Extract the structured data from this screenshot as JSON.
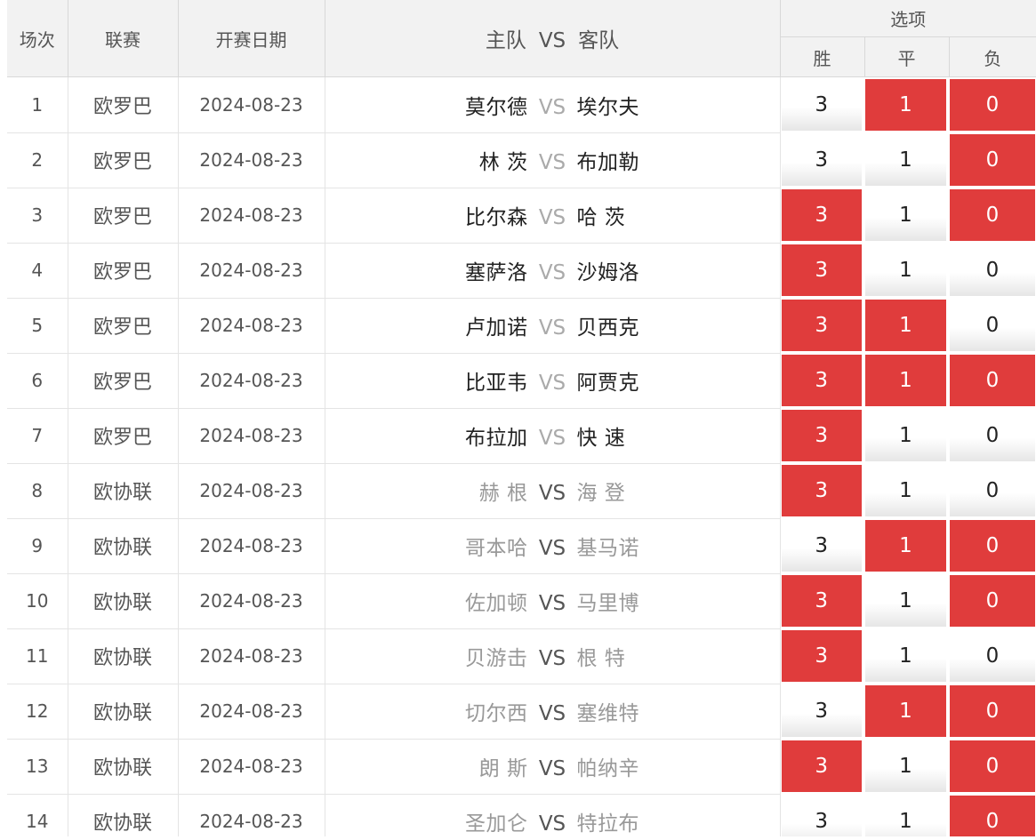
{
  "header": {
    "index": "场次",
    "league": "联赛",
    "date": "开赛日期",
    "home": "主队",
    "vs": "VS",
    "away": "客队",
    "options": "选项",
    "win": "胜",
    "draw": "平",
    "lose": "负"
  },
  "accent_color": "#e03c3c",
  "rows": [
    {
      "index": "1",
      "league": "欧罗巴",
      "date": "2024-08-23",
      "home": "莫尔德",
      "vs": "VS",
      "away": "埃尔夫",
      "style": "dark",
      "win": "3",
      "draw": "1",
      "lose": "0",
      "sel": [
        false,
        true,
        true
      ]
    },
    {
      "index": "2",
      "league": "欧罗巴",
      "date": "2024-08-23",
      "home": "林 茨",
      "vs": "VS",
      "away": "布加勒",
      "style": "dark",
      "win": "3",
      "draw": "1",
      "lose": "0",
      "sel": [
        false,
        false,
        true
      ]
    },
    {
      "index": "3",
      "league": "欧罗巴",
      "date": "2024-08-23",
      "home": "比尔森",
      "vs": "VS",
      "away": "哈 茨",
      "style": "dark",
      "win": "3",
      "draw": "1",
      "lose": "0",
      "sel": [
        true,
        false,
        true
      ]
    },
    {
      "index": "4",
      "league": "欧罗巴",
      "date": "2024-08-23",
      "home": "塞萨洛",
      "vs": "VS",
      "away": "沙姆洛",
      "style": "dark",
      "win": "3",
      "draw": "1",
      "lose": "0",
      "sel": [
        true,
        false,
        false
      ]
    },
    {
      "index": "5",
      "league": "欧罗巴",
      "date": "2024-08-23",
      "home": "卢加诺",
      "vs": "VS",
      "away": "贝西克",
      "style": "dark",
      "win": "3",
      "draw": "1",
      "lose": "0",
      "sel": [
        true,
        true,
        false
      ]
    },
    {
      "index": "6",
      "league": "欧罗巴",
      "date": "2024-08-23",
      "home": "比亚韦",
      "vs": "VS",
      "away": "阿贾克",
      "style": "dark",
      "win": "3",
      "draw": "1",
      "lose": "0",
      "sel": [
        true,
        true,
        true
      ]
    },
    {
      "index": "7",
      "league": "欧罗巴",
      "date": "2024-08-23",
      "home": "布拉加",
      "vs": "VS",
      "away": "快 速",
      "style": "dark",
      "win": "3",
      "draw": "1",
      "lose": "0",
      "sel": [
        true,
        false,
        false
      ]
    },
    {
      "index": "8",
      "league": "欧协联",
      "date": "2024-08-23",
      "home": "赫 根",
      "vs": "VS",
      "away": "海 登",
      "style": "light",
      "win": "3",
      "draw": "1",
      "lose": "0",
      "sel": [
        true,
        false,
        false
      ]
    },
    {
      "index": "9",
      "league": "欧协联",
      "date": "2024-08-23",
      "home": "哥本哈",
      "vs": "VS",
      "away": "基马诺",
      "style": "light",
      "win": "3",
      "draw": "1",
      "lose": "0",
      "sel": [
        false,
        true,
        true
      ]
    },
    {
      "index": "10",
      "league": "欧协联",
      "date": "2024-08-23",
      "home": "佐加顿",
      "vs": "VS",
      "away": "马里博",
      "style": "light",
      "win": "3",
      "draw": "1",
      "lose": "0",
      "sel": [
        true,
        false,
        true
      ]
    },
    {
      "index": "11",
      "league": "欧协联",
      "date": "2024-08-23",
      "home": "贝游击",
      "vs": "VS",
      "away": "根 特",
      "style": "light",
      "win": "3",
      "draw": "1",
      "lose": "0",
      "sel": [
        true,
        false,
        false
      ]
    },
    {
      "index": "12",
      "league": "欧协联",
      "date": "2024-08-23",
      "home": "切尔西",
      "vs": "VS",
      "away": "塞维特",
      "style": "light",
      "win": "3",
      "draw": "1",
      "lose": "0",
      "sel": [
        false,
        true,
        true
      ]
    },
    {
      "index": "13",
      "league": "欧协联",
      "date": "2024-08-23",
      "home": "朗 斯",
      "vs": "VS",
      "away": "帕纳辛",
      "style": "light",
      "win": "3",
      "draw": "1",
      "lose": "0",
      "sel": [
        true,
        false,
        true
      ]
    },
    {
      "index": "14",
      "league": "欧协联",
      "date": "2024-08-23",
      "home": "圣加仑",
      "vs": "VS",
      "away": "特拉布",
      "style": "light",
      "win": "3",
      "draw": "1",
      "lose": "0",
      "sel": [
        false,
        false,
        true
      ]
    }
  ]
}
